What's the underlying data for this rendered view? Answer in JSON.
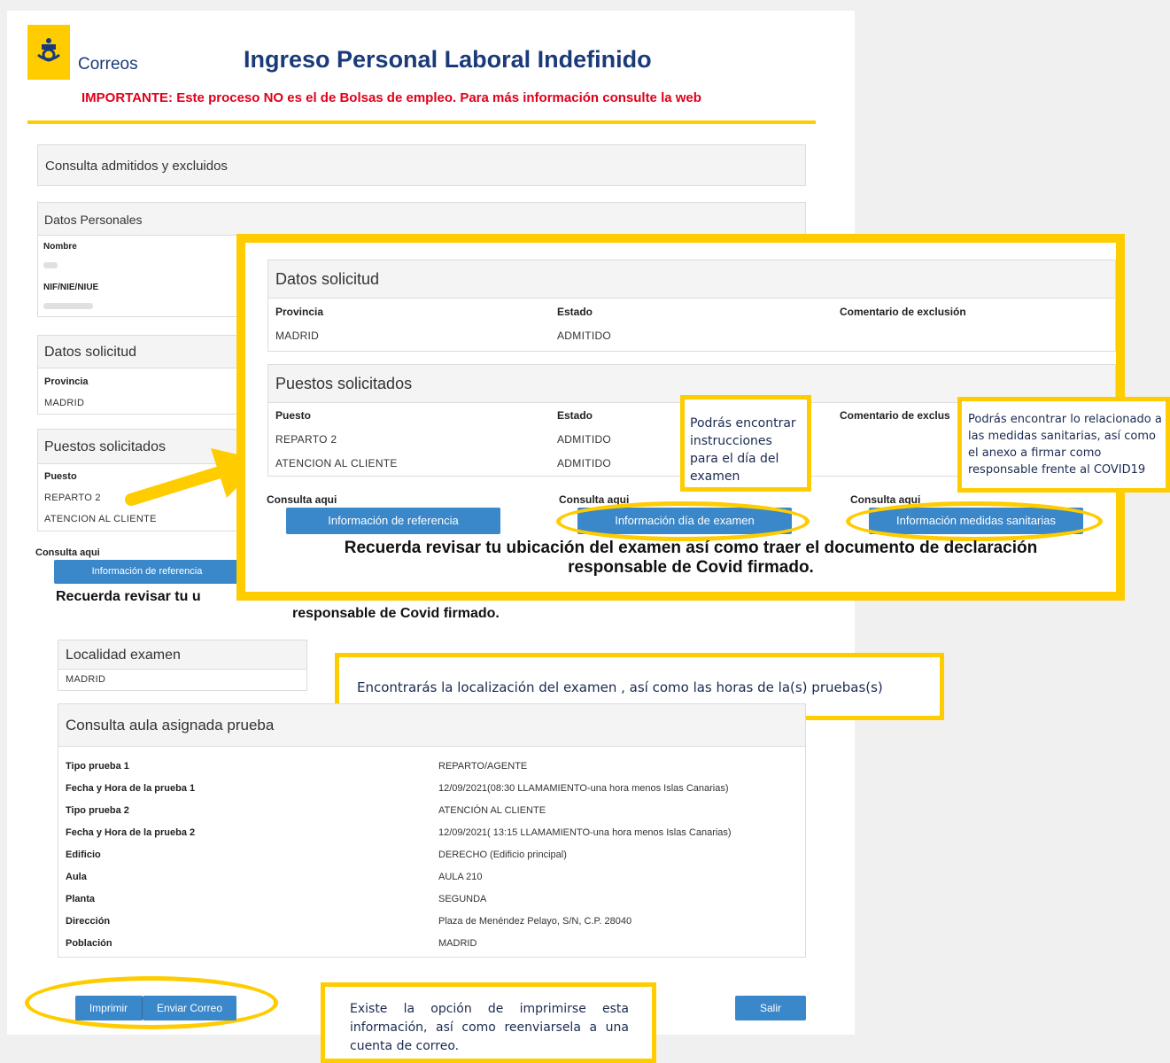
{
  "header": {
    "logo_text": "Correos",
    "title": "Ingreso Personal Laboral Indefinido",
    "important": "IMPORTANTE: Este proceso NO es el de Bolsas de empleo. Para más información consulte la web"
  },
  "consulta_box": {
    "title": "Consulta admitidos y excluidos"
  },
  "datos_personales": {
    "title": "Datos Personales",
    "nombre_label": "Nombre",
    "nif_label": "NIF/NIE/NIUE"
  },
  "datos_solicitud": {
    "title": "Datos solicitud",
    "provincia_label": "Provincia",
    "provincia_value": "MADRID",
    "estado_label": "Estado",
    "estado_value": "ADMITIDO",
    "comentario_label": "Comentario de exclusión"
  },
  "puestos": {
    "title": "Puestos solicitados",
    "puesto_label": "Puesto",
    "estado_label": "Estado",
    "comentario_label": "Comentario de exclus",
    "rows": [
      {
        "puesto": "REPARTO 2",
        "estado": "ADMITIDO"
      },
      {
        "puesto": "ATENCION AL CLIENTE",
        "estado": "ADMITIDO"
      }
    ]
  },
  "consulta_aqui": "Consulta aqui",
  "buttons": {
    "referencia": "Información de referencia",
    "examen": "Información día de examen",
    "sanitarias": "Información medidas sanitarias",
    "imprimir": "Imprimir",
    "enviar_correo": "Enviar Correo",
    "salir": "Salir"
  },
  "reminder": {
    "line1": "Recuerda revisar tu ubicación del examen así como traer el documento de declaración",
    "line2": "responsable de Covid firmado.",
    "line1_partial": "Recuerda revisar tu u"
  },
  "localidad": {
    "title": "Localidad examen",
    "value": "MADRID"
  },
  "aula": {
    "title": "Consulta aula asignada prueba",
    "rows": [
      {
        "label": "Tipo prueba 1",
        "value": "REPARTO/AGENTE"
      },
      {
        "label": "Fecha y Hora de la prueba 1",
        "value": "12/09/2021(08:30 LLAMAMIENTO-una hora menos Islas Canarias)"
      },
      {
        "label": "Tipo prueba 2",
        "value": "ATENCIÓN AL CLIENTE"
      },
      {
        "label": "Fecha y Hora de la prueba 2",
        "value": "12/09/2021( 13:15 LLAMAMIENTO-una hora menos Islas Canarias)"
      },
      {
        "label": "Edificio",
        "value": "DERECHO (Edificio principal)"
      },
      {
        "label": "Aula",
        "value": "AULA 210"
      },
      {
        "label": "Planta",
        "value": "SEGUNDA"
      },
      {
        "label": "Dirección",
        "value": "Plaza de Menéndez Pelayo, S/N, C.P. 28040"
      },
      {
        "label": "Población",
        "value": "MADRID"
      }
    ]
  },
  "notes": {
    "examen_day": "Podrás encontrar instrucciones para el día del examen",
    "sanitarias": "Podrás encontrar lo relacionado a las medidas sanitarias, así como el anexo a firmar como responsable frente al COVID19",
    "localizacion": "Encontrarás la localización del examen , así como las horas de la(s) pruebas(s)",
    "imprimir": "Existe la opción de imprimirse esta información, así como reenviarsela a una cuenta de correo."
  },
  "colors": {
    "highlight": "#ffcc00",
    "button": "#3a87c9",
    "title": "#1a3a7a",
    "alert": "#e0001a"
  }
}
